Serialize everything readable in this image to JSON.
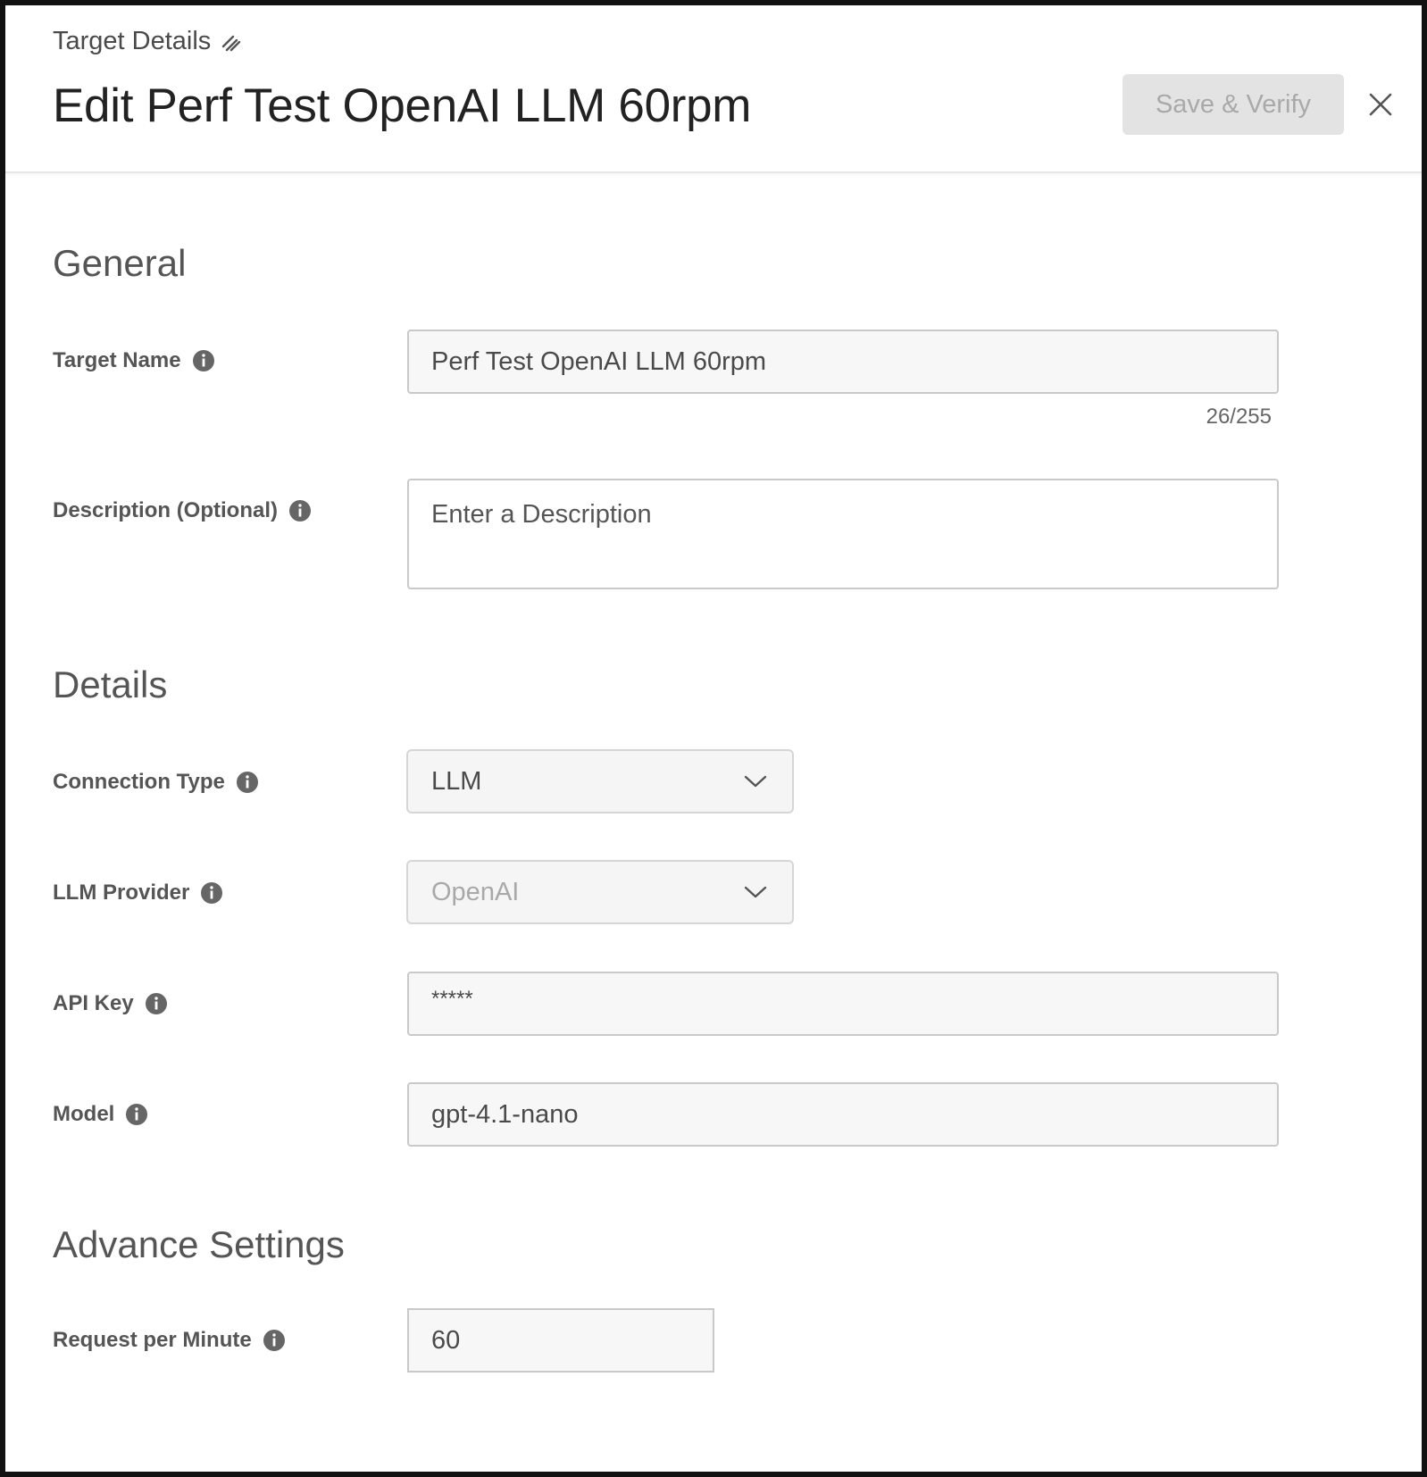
{
  "header": {
    "breadcrumb": "Target Details",
    "title": "Edit Perf Test OpenAI LLM 60rpm",
    "save_label": "Save & Verify"
  },
  "general": {
    "heading": "General",
    "target_name": {
      "label": "Target Name",
      "value": "Perf Test OpenAI LLM 60rpm",
      "counter": "26/255"
    },
    "description": {
      "label": "Description (Optional)",
      "placeholder": "Enter a Description",
      "value": ""
    }
  },
  "details": {
    "heading": "Details",
    "connection_type": {
      "label": "Connection Type",
      "value": "LLM"
    },
    "llm_provider": {
      "label": "LLM Provider",
      "value": "OpenAI"
    },
    "api_key": {
      "label": "API Key",
      "value": "*****"
    },
    "model": {
      "label": "Model",
      "value": "gpt-4.1-nano"
    }
  },
  "advanced": {
    "heading": "Advance Settings",
    "request_per_minute": {
      "label": "Request per Minute",
      "value": "60"
    }
  },
  "icons": {
    "breadcrumb": "edit-pencil-icon",
    "info": "info-icon",
    "close": "close-icon",
    "dropdown": "chevron-down-icon"
  },
  "colors": {
    "button_disabled_bg": "#e3e3e3",
    "button_disabled_text": "#a9a9a9",
    "input_bg": "#f7f7f7",
    "input_border": "#c9c9c9",
    "frame_border": "#111111"
  }
}
